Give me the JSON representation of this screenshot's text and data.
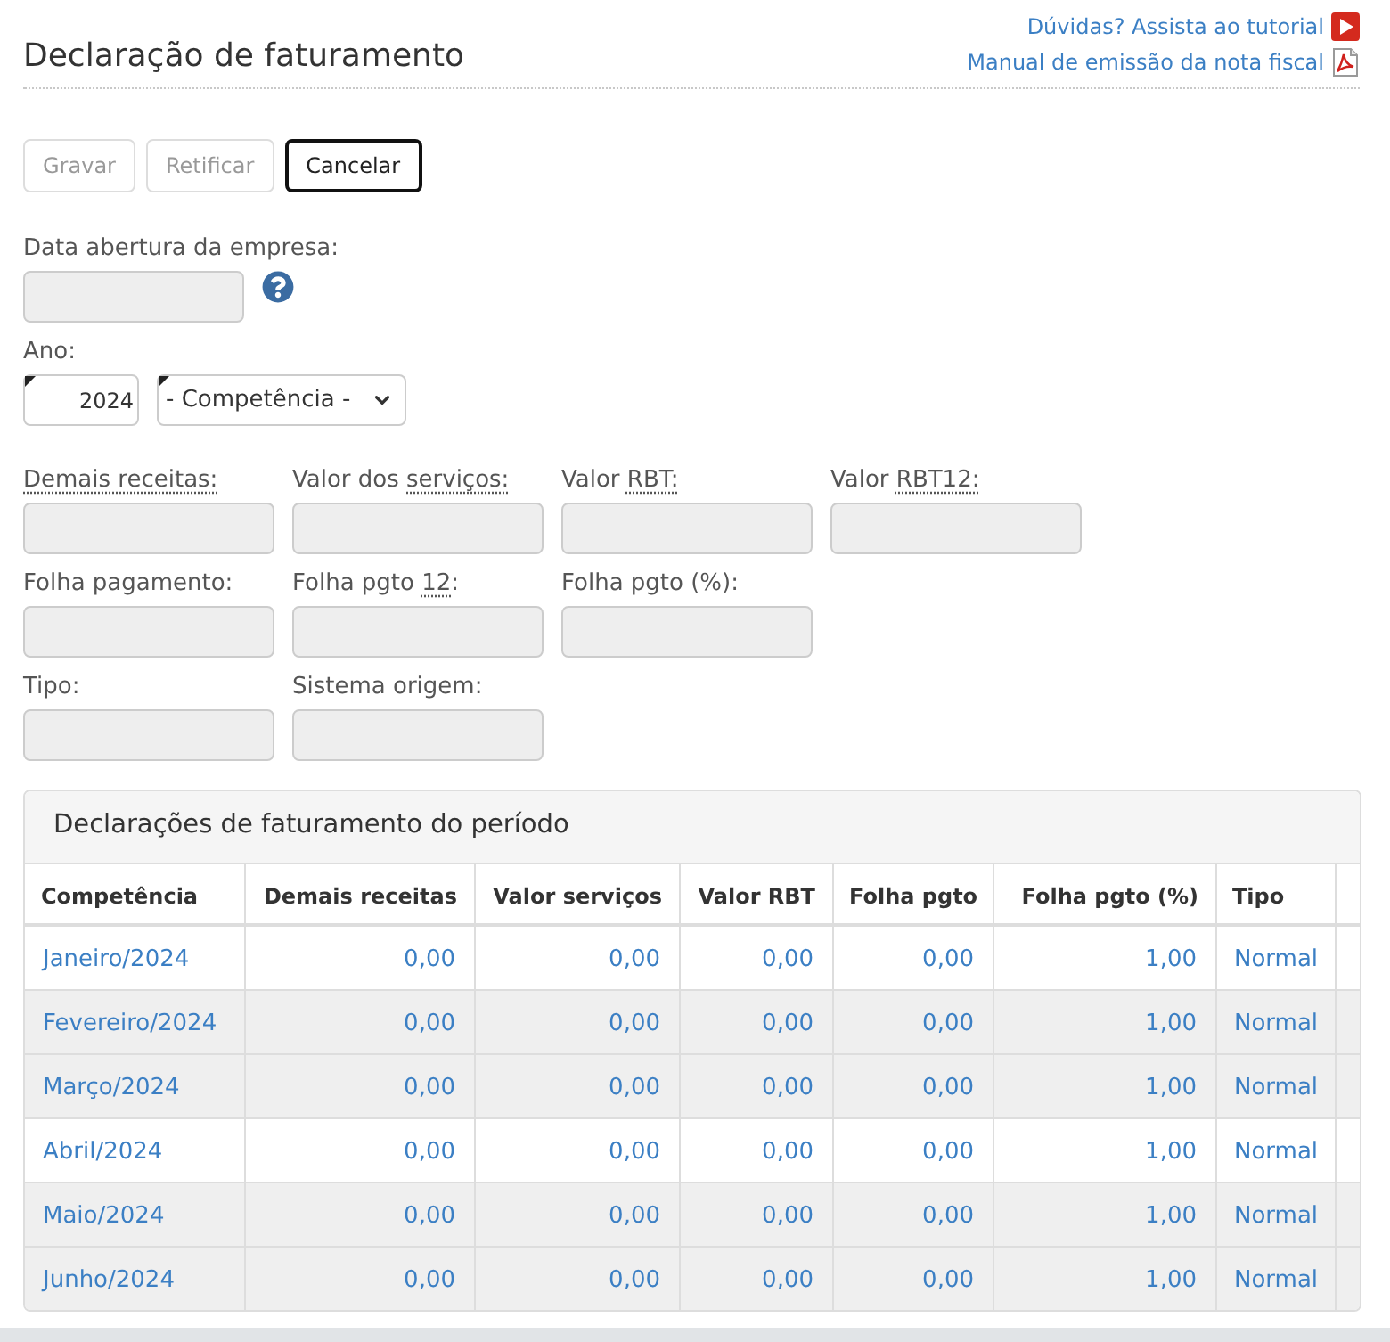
{
  "header": {
    "title": "Declaração de faturamento",
    "links": [
      {
        "text": "Dúvidas? Assista ao tutorial",
        "kind": "video"
      },
      {
        "text": "Manual de emissão da nota fiscal",
        "kind": "pdf"
      }
    ]
  },
  "buttons": [
    {
      "label": "Gravar",
      "disabled": true,
      "focused": false
    },
    {
      "label": "Retificar",
      "disabled": true,
      "focused": false
    },
    {
      "label": "Cancelar",
      "disabled": false,
      "focused": true
    }
  ],
  "opening_date": {
    "label": "Data abertura da empresa:",
    "disabled": true,
    "help": true
  },
  "year": {
    "label": "Ano:",
    "value": "2024",
    "required": true,
    "period": {
      "value": "- Competência -",
      "required": true
    }
  },
  "field_rows": [
    [
      {
        "label_parts": [
          {
            "text": "Demais receitas:",
            "abbr": true
          }
        ],
        "disabled": true
      },
      {
        "label_parts": [
          {
            "text": "Valor dos ",
            "abbr": false
          },
          {
            "text": "serviços:",
            "abbr": true
          }
        ],
        "disabled": true
      },
      {
        "label_parts": [
          {
            "text": "Valor ",
            "abbr": false
          },
          {
            "text": "RBT:",
            "abbr": true
          }
        ],
        "disabled": true
      },
      {
        "label_parts": [
          {
            "text": "Valor ",
            "abbr": false
          },
          {
            "text": "RBT12:",
            "abbr": true
          }
        ],
        "disabled": true
      }
    ],
    [
      {
        "label_parts": [
          {
            "text": "Folha pagamento:",
            "abbr": false
          }
        ],
        "disabled": true
      },
      {
        "label_parts": [
          {
            "text": "Folha pgto ",
            "abbr": false
          },
          {
            "text": "12",
            "abbr": true
          },
          {
            "text": ":",
            "abbr": false
          }
        ],
        "disabled": true
      },
      {
        "label_parts": [
          {
            "text": "Folha pgto (%):",
            "abbr": false
          }
        ],
        "disabled": true
      }
    ],
    [
      {
        "label_parts": [
          {
            "text": "Tipo:",
            "abbr": false
          }
        ],
        "disabled": true
      },
      {
        "label_parts": [
          {
            "text": "Sistema origem:",
            "abbr": false
          }
        ],
        "disabled": true
      }
    ]
  ],
  "table": {
    "title": "Declarações de faturamento do período",
    "columns": [
      {
        "label": "Competência",
        "kind": "text"
      },
      {
        "label": "Demais receitas",
        "kind": "number"
      },
      {
        "label": "Valor serviços",
        "kind": "number"
      },
      {
        "label": "Valor RBT",
        "kind": "number"
      },
      {
        "label": "Folha pgto",
        "kind": "number"
      },
      {
        "label": "Folha pgto (%)",
        "kind": "number"
      },
      {
        "label": "Tipo",
        "kind": "text"
      }
    ],
    "rows": [
      {
        "shaded": false,
        "cells": [
          "Janeiro/2024",
          "0,00",
          "0,00",
          "0,00",
          "0,00",
          "1,00",
          "Normal"
        ]
      },
      {
        "shaded": true,
        "cells": [
          "Fevereiro/2024",
          "0,00",
          "0,00",
          "0,00",
          "0,00",
          "1,00",
          "Normal"
        ]
      },
      {
        "shaded": true,
        "cells": [
          "Março/2024",
          "0,00",
          "0,00",
          "0,00",
          "0,00",
          "1,00",
          "Normal"
        ]
      },
      {
        "shaded": false,
        "cells": [
          "Abril/2024",
          "0,00",
          "0,00",
          "0,00",
          "0,00",
          "1,00",
          "Normal"
        ]
      },
      {
        "shaded": true,
        "cells": [
          "Maio/2024",
          "0,00",
          "0,00",
          "0,00",
          "0,00",
          "1,00",
          "Normal"
        ]
      },
      {
        "shaded": true,
        "cells": [
          "Junho/2024",
          "0,00",
          "0,00",
          "0,00",
          "0,00",
          "1,00",
          "Normal"
        ]
      }
    ]
  }
}
